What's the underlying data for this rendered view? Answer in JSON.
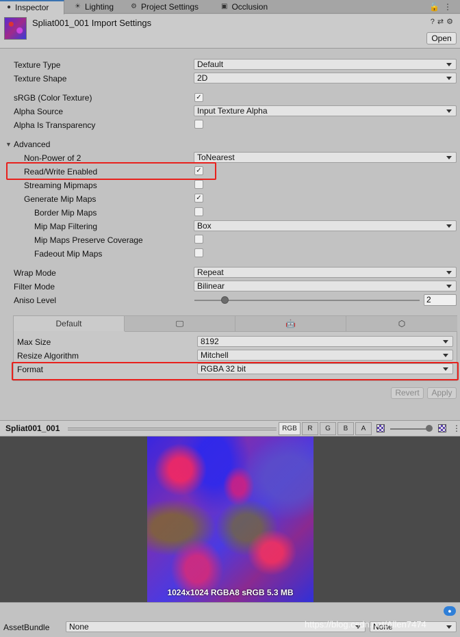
{
  "tabs": [
    {
      "label": "Inspector",
      "icon": "info-icon"
    },
    {
      "label": "Lighting",
      "icon": "bulb-icon"
    },
    {
      "label": "Project Settings",
      "icon": "gear-icon"
    },
    {
      "label": "Occlusion",
      "icon": "occlusion-icon"
    }
  ],
  "header": {
    "title": "Spliat001_001 Import Settings",
    "open_label": "Open"
  },
  "settings": {
    "texture_type": {
      "label": "Texture Type",
      "value": "Default"
    },
    "texture_shape": {
      "label": "Texture Shape",
      "value": "2D"
    },
    "srgb": {
      "label": "sRGB (Color Texture)",
      "checked": true
    },
    "alpha_source": {
      "label": "Alpha Source",
      "value": "Input Texture Alpha"
    },
    "alpha_transparency": {
      "label": "Alpha Is Transparency",
      "checked": false
    },
    "advanced_label": "Advanced",
    "non_power_of_2": {
      "label": "Non-Power of 2",
      "value": "ToNearest"
    },
    "read_write": {
      "label": "Read/Write Enabled",
      "checked": true
    },
    "streaming_mipmaps": {
      "label": "Streaming Mipmaps",
      "checked": false
    },
    "generate_mip_maps": {
      "label": "Generate Mip Maps",
      "checked": true
    },
    "border_mip_maps": {
      "label": "Border Mip Maps",
      "checked": false
    },
    "mip_map_filtering": {
      "label": "Mip Map Filtering",
      "value": "Box"
    },
    "mip_preserve_coverage": {
      "label": "Mip Maps Preserve Coverage",
      "checked": false
    },
    "fadeout_mip_maps": {
      "label": "Fadeout Mip Maps",
      "checked": false
    },
    "wrap_mode": {
      "label": "Wrap Mode",
      "value": "Repeat"
    },
    "filter_mode": {
      "label": "Filter Mode",
      "value": "Bilinear"
    },
    "aniso_level": {
      "label": "Aniso Level",
      "value": "2"
    }
  },
  "platform": {
    "tabs": [
      {
        "label": "Default"
      },
      {
        "icon": "monitor-icon"
      },
      {
        "icon": "android-icon"
      },
      {
        "icon": "html5-icon"
      }
    ],
    "max_size": {
      "label": "Max Size",
      "value": "8192"
    },
    "resize_algorithm": {
      "label": "Resize Algorithm",
      "value": "Mitchell"
    },
    "format": {
      "label": "Format",
      "value": "RGBA 32 bit"
    }
  },
  "actions": {
    "revert": "Revert",
    "apply": "Apply"
  },
  "preview": {
    "title": "Spliat001_001",
    "channels": [
      "RGB",
      "R",
      "G",
      "B",
      "A"
    ],
    "info": "1024x1024  RGBA8 sRGB  5.3 MB"
  },
  "asset_bundle": {
    "label": "AssetBundle",
    "value": "None",
    "variant": "None"
  },
  "watermark": "https://blog.csdn.net/Allen7474"
}
